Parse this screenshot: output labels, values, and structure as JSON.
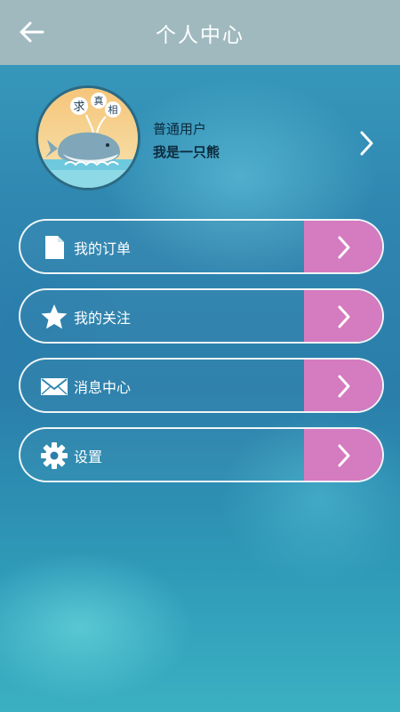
{
  "header": {
    "title": "个人中心",
    "back_icon": "back-arrow-icon"
  },
  "profile": {
    "avatar_text": [
      "求",
      "真",
      "相"
    ],
    "user_type": "普通用户",
    "username": "我是一只熊",
    "arrow_icon": "chevron-right-icon"
  },
  "menu": {
    "items": [
      {
        "label": "我的订单",
        "icon": "document-icon"
      },
      {
        "label": "我的关注",
        "icon": "star-icon"
      },
      {
        "label": "消息中心",
        "icon": "envelope-icon"
      },
      {
        "label": "设置",
        "icon": "gear-icon"
      }
    ]
  },
  "colors": {
    "header_bg": "#9fb9bf",
    "arrow_button_bg": "#d57bc0",
    "text_light": "#ffffff",
    "text_dark": "#0d2a3c"
  }
}
